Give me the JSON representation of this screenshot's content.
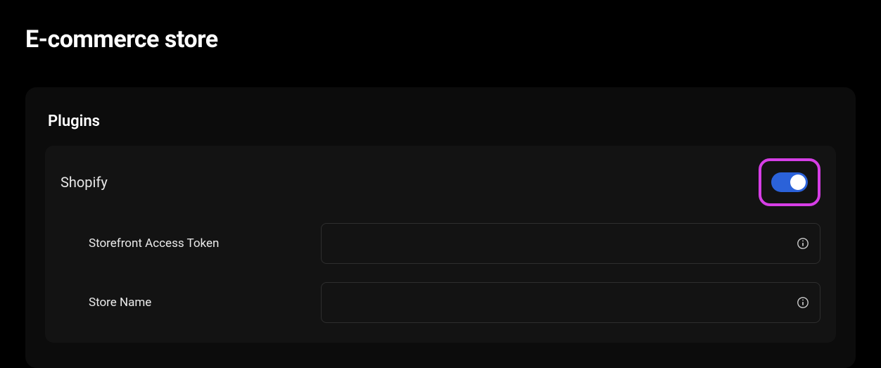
{
  "page": {
    "title": "E-commerce store"
  },
  "section": {
    "title": "Plugins"
  },
  "plugin": {
    "name": "Shopify",
    "enabled": true,
    "fields": [
      {
        "label": "Storefront Access Token",
        "value": ""
      },
      {
        "label": "Store Name",
        "value": ""
      }
    ]
  }
}
